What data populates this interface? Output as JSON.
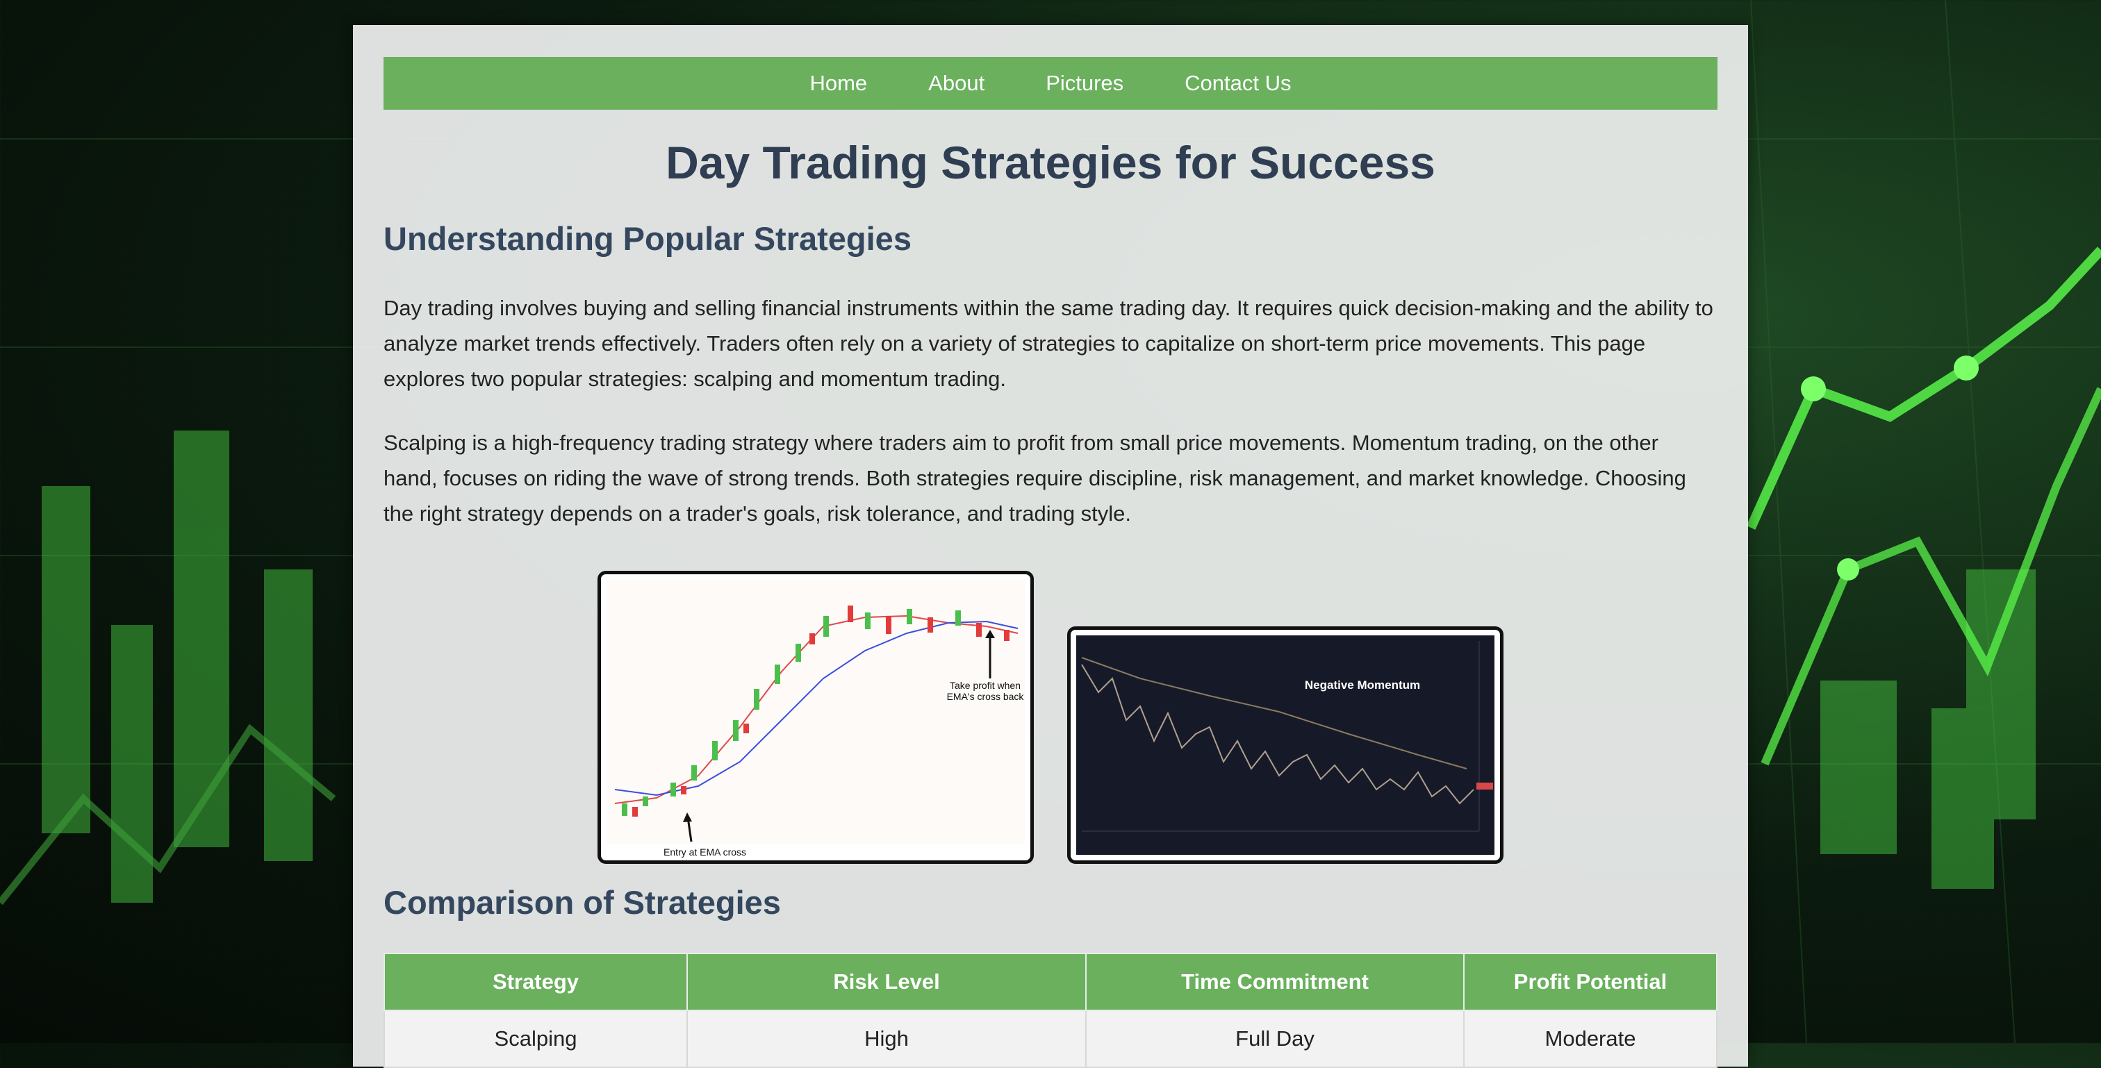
{
  "nav": {
    "items": [
      "Home",
      "About",
      "Pictures",
      "Contact Us"
    ]
  },
  "page": {
    "title": "Day Trading Strategies for Success",
    "section1_heading": "Understanding Popular Strategies",
    "paragraph1": "Day trading involves buying and selling financial instruments within the same trading day. It requires quick decision-making and the ability to analyze market trends effectively. Traders often rely on a variety of strategies to capitalize on short-term price movements. This page explores two popular strategies: scalping and momentum trading.",
    "paragraph2": "Scalping is a high-frequency trading strategy where traders aim to profit from small price movements. Momentum trading, on the other hand, focuses on riding the wave of strong trends. Both strategies require discipline, risk management, and market knowledge. Choosing the right strategy depends on a trader's goals, risk tolerance, and trading style.",
    "section2_heading": "Comparison of Strategies"
  },
  "images": {
    "scalping_chart": {
      "annotation_take_profit_line1": "Take profit when",
      "annotation_take_profit_line2": "EMA's cross back",
      "annotation_entry": "Entry at EMA cross"
    },
    "momentum_chart": {
      "label": "Negative Momentum"
    }
  },
  "table": {
    "headers": [
      "Strategy",
      "Risk Level",
      "Time Commitment",
      "Profit Potential"
    ],
    "rows": [
      [
        "Scalping",
        "High",
        "Full Day",
        "Moderate"
      ]
    ]
  },
  "colors": {
    "accent": "#6ab05d",
    "heading": "#34475f",
    "background": "#0b1a0e"
  }
}
